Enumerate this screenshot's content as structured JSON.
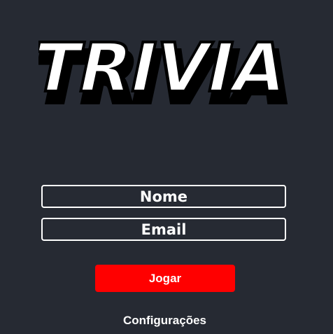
{
  "logo": {
    "text": "TRIVIA"
  },
  "form": {
    "name_placeholder": "Nome",
    "email_placeholder": "Email",
    "play_label": "Jogar",
    "settings_label": "Configurações"
  },
  "colors": {
    "background": "#262a33",
    "button": "#ff0000",
    "text": "#ffffff"
  }
}
